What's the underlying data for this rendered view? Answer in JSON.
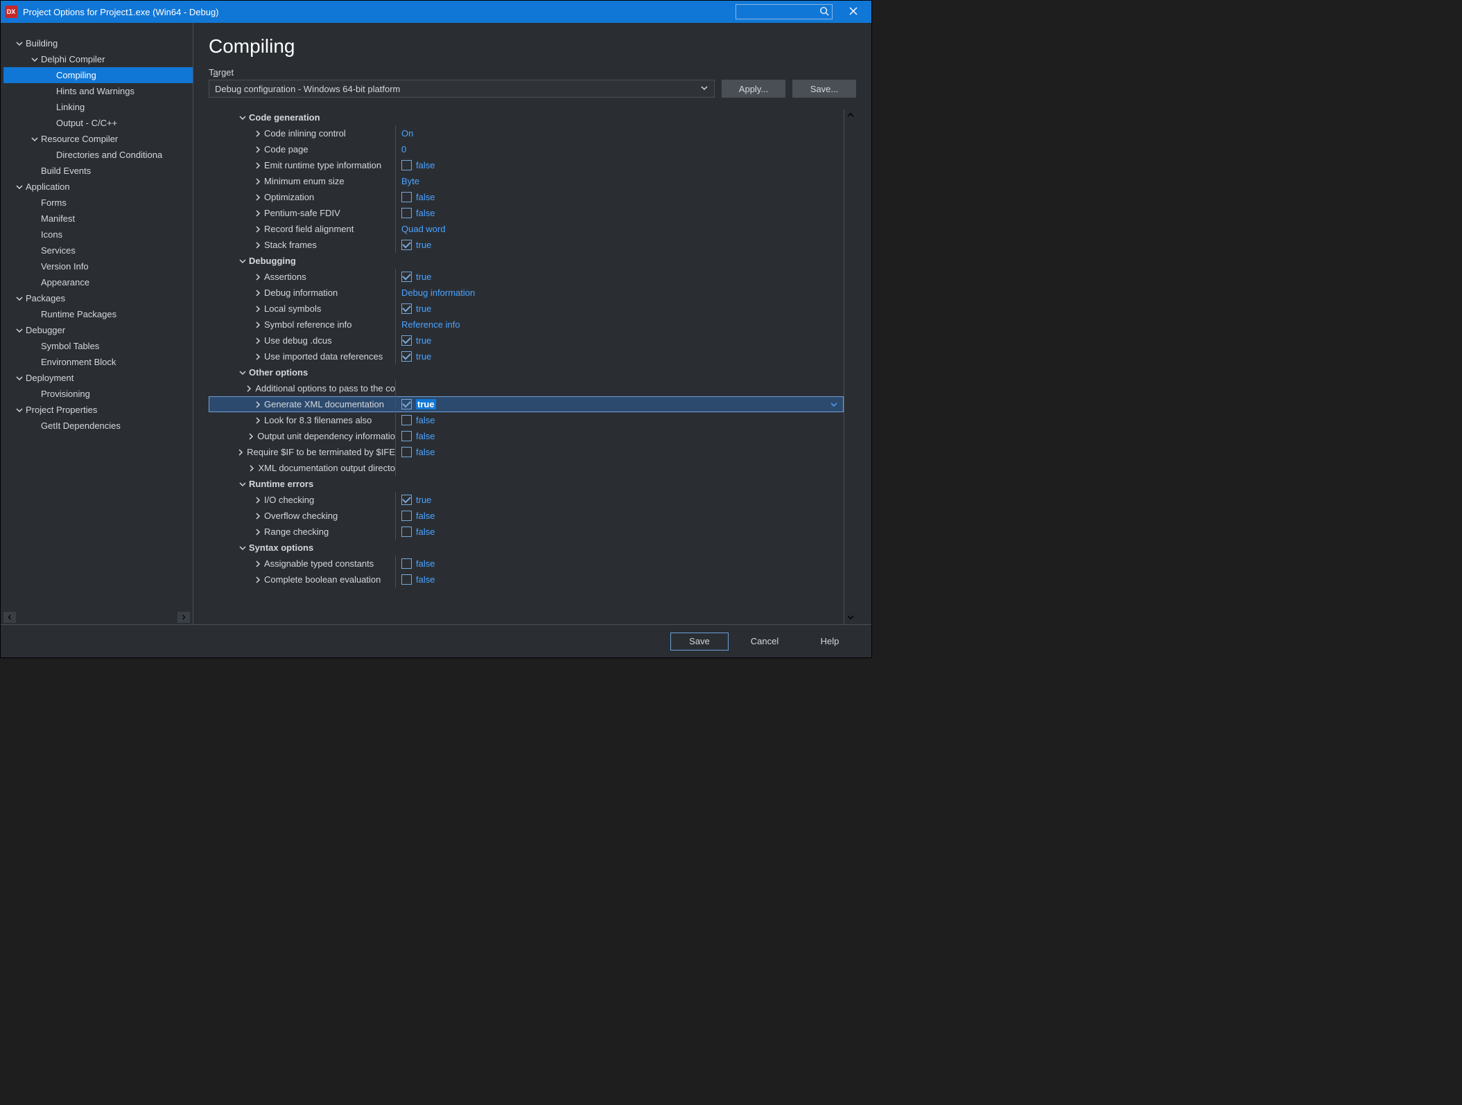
{
  "window": {
    "title": "Project Options for Project1.exe  (Win64 - Debug)",
    "app_icon_text": "DX"
  },
  "search": {
    "placeholder": ""
  },
  "sidebar": {
    "items": [
      {
        "id": "building",
        "label": "Building",
        "depth": 0,
        "expanded": true,
        "has_children": true
      },
      {
        "id": "delphi-compiler",
        "label": "Delphi Compiler",
        "depth": 1,
        "expanded": true,
        "has_children": true
      },
      {
        "id": "compiling",
        "label": "Compiling",
        "depth": 2,
        "expanded": false,
        "has_children": false,
        "selected": true
      },
      {
        "id": "hints-warnings",
        "label": "Hints and Warnings",
        "depth": 2,
        "expanded": false,
        "has_children": false
      },
      {
        "id": "linking",
        "label": "Linking",
        "depth": 2,
        "expanded": false,
        "has_children": false
      },
      {
        "id": "output-ccpp",
        "label": "Output - C/C++",
        "depth": 2,
        "expanded": false,
        "has_children": false
      },
      {
        "id": "resource-compiler",
        "label": "Resource Compiler",
        "depth": 1,
        "expanded": true,
        "has_children": true
      },
      {
        "id": "dirs-cond",
        "label": "Directories and Conditiona",
        "depth": 2,
        "expanded": false,
        "has_children": false
      },
      {
        "id": "build-events",
        "label": "Build Events",
        "depth": 1,
        "expanded": false,
        "has_children": false
      },
      {
        "id": "application",
        "label": "Application",
        "depth": 0,
        "expanded": true,
        "has_children": true
      },
      {
        "id": "forms",
        "label": "Forms",
        "depth": 1,
        "expanded": false,
        "has_children": false
      },
      {
        "id": "manifest",
        "label": "Manifest",
        "depth": 1,
        "expanded": false,
        "has_children": false
      },
      {
        "id": "icons",
        "label": "Icons",
        "depth": 1,
        "expanded": false,
        "has_children": false
      },
      {
        "id": "services",
        "label": "Services",
        "depth": 1,
        "expanded": false,
        "has_children": false
      },
      {
        "id": "version-info",
        "label": "Version Info",
        "depth": 1,
        "expanded": false,
        "has_children": false
      },
      {
        "id": "appearance",
        "label": "Appearance",
        "depth": 1,
        "expanded": false,
        "has_children": false
      },
      {
        "id": "packages",
        "label": "Packages",
        "depth": 0,
        "expanded": true,
        "has_children": true
      },
      {
        "id": "runtime-packages",
        "label": "Runtime Packages",
        "depth": 1,
        "expanded": false,
        "has_children": false
      },
      {
        "id": "debugger",
        "label": "Debugger",
        "depth": 0,
        "expanded": true,
        "has_children": true
      },
      {
        "id": "symbol-tables",
        "label": "Symbol Tables",
        "depth": 1,
        "expanded": false,
        "has_children": false
      },
      {
        "id": "env-block",
        "label": "Environment Block",
        "depth": 1,
        "expanded": false,
        "has_children": false
      },
      {
        "id": "deployment",
        "label": "Deployment",
        "depth": 0,
        "expanded": true,
        "has_children": true
      },
      {
        "id": "provisioning",
        "label": "Provisioning",
        "depth": 1,
        "expanded": false,
        "has_children": false
      },
      {
        "id": "project-properties",
        "label": "Project Properties",
        "depth": 0,
        "expanded": true,
        "has_children": true
      },
      {
        "id": "getit-deps",
        "label": "GetIt Dependencies",
        "depth": 1,
        "expanded": false,
        "has_children": false
      }
    ]
  },
  "page": {
    "title": "Compiling",
    "target_label_pre": "T",
    "target_label_ul": "a",
    "target_label_post": "rget",
    "target_value": "Debug configuration - Windows 64-bit platform",
    "apply_label": "Apply...",
    "save_label": "Save..."
  },
  "props": {
    "categories": [
      {
        "id": "code-gen",
        "label": "Code generation",
        "items": [
          {
            "id": "inline",
            "label": "Code inlining control",
            "type": "text",
            "value": "On"
          },
          {
            "id": "codepage",
            "label": "Code page",
            "type": "text",
            "value": "0"
          },
          {
            "id": "rtti",
            "label": "Emit runtime type information",
            "type": "bool",
            "value": "false",
            "checked": false
          },
          {
            "id": "enum",
            "label": "Minimum enum size",
            "type": "text",
            "value": "Byte"
          },
          {
            "id": "opt",
            "label": "Optimization",
            "type": "bool",
            "value": "false",
            "checked": false
          },
          {
            "id": "fdiv",
            "label": "Pentium-safe FDIV",
            "type": "bool",
            "value": "false",
            "checked": false
          },
          {
            "id": "align",
            "label": "Record field alignment",
            "type": "text",
            "value": "Quad word"
          },
          {
            "id": "stack",
            "label": "Stack frames",
            "type": "bool",
            "value": "true",
            "checked": true
          }
        ]
      },
      {
        "id": "debugging",
        "label": "Debugging",
        "items": [
          {
            "id": "assert",
            "label": "Assertions",
            "type": "bool",
            "value": "true",
            "checked": true
          },
          {
            "id": "dbginfo",
            "label": "Debug information",
            "type": "text",
            "value": "Debug information"
          },
          {
            "id": "local",
            "label": "Local symbols",
            "type": "bool",
            "value": "true",
            "checked": true
          },
          {
            "id": "symref",
            "label": "Symbol reference info",
            "type": "text",
            "value": "Reference info"
          },
          {
            "id": "dcus",
            "label": "Use debug .dcus",
            "type": "bool",
            "value": "true",
            "checked": true
          },
          {
            "id": "imported",
            "label": "Use imported data references",
            "type": "bool",
            "value": "true",
            "checked": true
          }
        ]
      },
      {
        "id": "other",
        "label": "Other options",
        "items": [
          {
            "id": "addopts",
            "label": "Additional options to pass to the co",
            "type": "text",
            "value": ""
          },
          {
            "id": "xmldoc",
            "label": "Generate XML documentation",
            "type": "bool",
            "value": "true",
            "checked": true,
            "selected": true,
            "editing": true
          },
          {
            "id": "look83",
            "label": "Look for 8.3 filenames also",
            "type": "bool",
            "value": "false",
            "checked": false
          },
          {
            "id": "unitdep",
            "label": "Output unit dependency informatio",
            "type": "bool",
            "value": "false",
            "checked": false
          },
          {
            "id": "reqif",
            "label": "Require $IF to be terminated by $IFE",
            "type": "bool",
            "value": "false",
            "checked": false
          },
          {
            "id": "xmlout",
            "label": "XML documentation output directo",
            "type": "text",
            "value": ""
          }
        ]
      },
      {
        "id": "runtime",
        "label": "Runtime errors",
        "items": [
          {
            "id": "io",
            "label": "I/O checking",
            "type": "bool",
            "value": "true",
            "checked": true
          },
          {
            "id": "overflow",
            "label": "Overflow checking",
            "type": "bool",
            "value": "false",
            "checked": false
          },
          {
            "id": "range",
            "label": "Range checking",
            "type": "bool",
            "value": "false",
            "checked": false
          }
        ]
      },
      {
        "id": "syntax",
        "label": "Syntax options",
        "items": [
          {
            "id": "assignable",
            "label": "Assignable typed constants",
            "type": "bool",
            "value": "false",
            "checked": false
          },
          {
            "id": "completebool",
            "label": "Complete boolean evaluation",
            "type": "bool",
            "value": "false",
            "checked": false
          }
        ]
      }
    ]
  },
  "footer": {
    "save": "Save",
    "cancel": "Cancel",
    "help": "Help"
  }
}
